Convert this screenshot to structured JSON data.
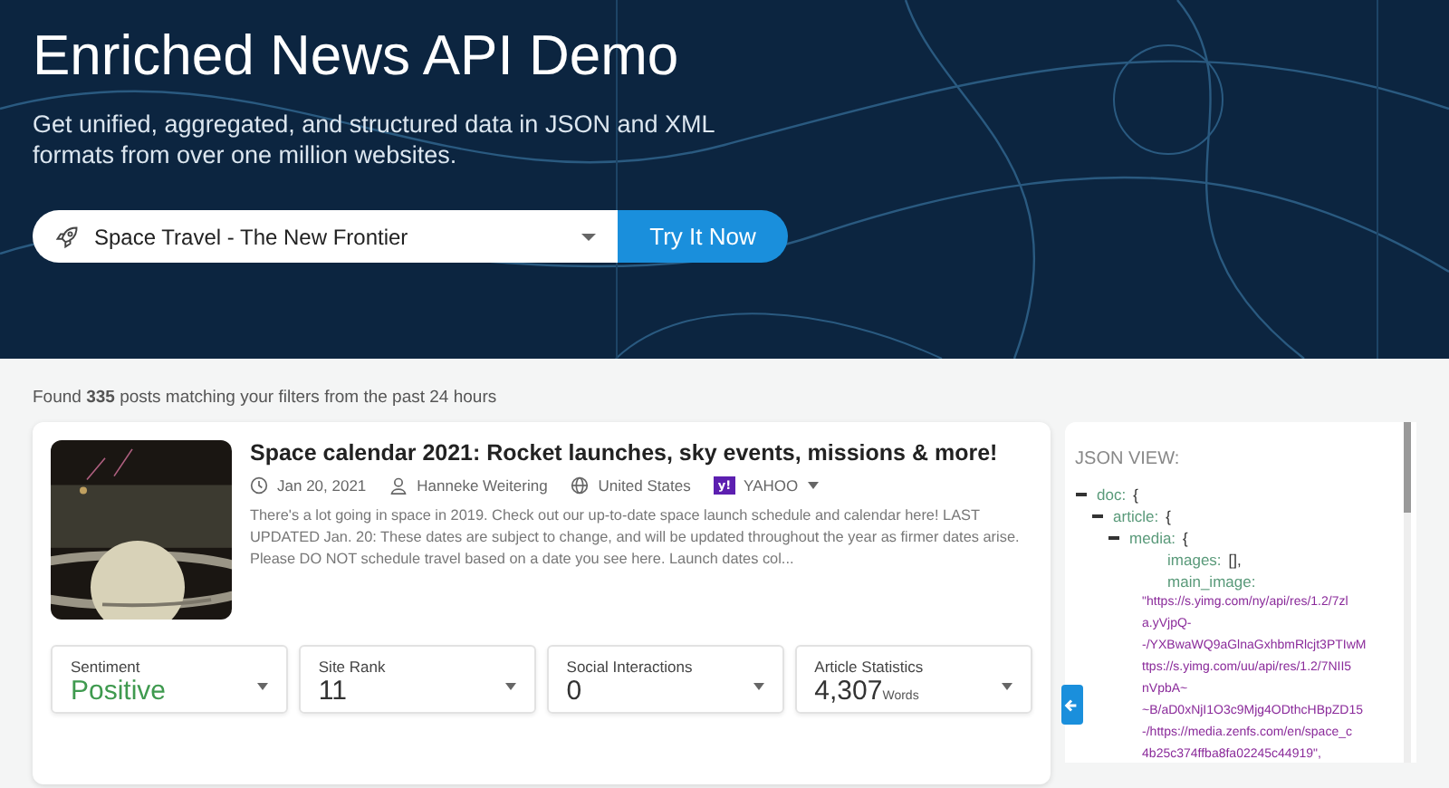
{
  "hero": {
    "title": "Enriched News API Demo",
    "subtitle": "Get unified, aggregated, and structured data in JSON and XML formats from over one million websites.",
    "select_value": "Space Travel - The New Frontier",
    "button": "Try It Now"
  },
  "results": {
    "count": "335",
    "summary_before": "Found",
    "summary_after": "posts matching your filters from the past 24 hours"
  },
  "article": {
    "title": "Space calendar 2021: Rocket launches, sky events, missions & more!",
    "date": "Jan 20, 2021",
    "author": "Hanneke Weitering",
    "country": "United States",
    "source_badge": "y!",
    "source": "YAHOO",
    "excerpt": "There's a lot going in space in 2019. Check out our up-to-date space launch schedule and calendar here! LAST UPDATED Jan. 20: These dates are subject to change, and will be updated throughout the year as firmer dates arise. Please DO NOT schedule travel based on a date you see here. Launch dates col...",
    "stats": [
      {
        "kind": "sentiment",
        "label": "Sentiment",
        "value": "Positive"
      },
      {
        "kind": "number",
        "label": "Site Rank",
        "value": "11"
      },
      {
        "kind": "number",
        "label": "Social Interactions",
        "value": "0"
      },
      {
        "kind": "number",
        "label": "Article Statistics",
        "value": "4,307",
        "unit": "Words"
      }
    ]
  },
  "json_view": {
    "title": "JSON VIEW:",
    "tree": [
      {
        "key": "doc:",
        "open": "{",
        "expanded": true,
        "children": [
          {
            "key": "article:",
            "open": "{",
            "expanded": true,
            "children": [
              {
                "key": "media:",
                "open": "{",
                "expanded": true,
                "children": [
                  {
                    "key": "images:",
                    "value": "[],"
                  },
                  {
                    "key": "main_image:",
                    "value_lines": [
                      "\"https://s.yimg.com/ny/api/res/1.2/7zl",
                      "a.yVjpQ-",
                      "-/YXBwaWQ9aGlnaGxhbmRlcjt3PTIwM",
                      "ttps://s.yimg.com/uu/api/res/1.2/7NII5",
                      "nVpbA~",
                      "~B/aD0xNjI1O3c9Mjg4ODthcHBpZD15",
                      "-/https://media.zenfs.com/en/space_c",
                      "4b25c374ffba8fa02245c44919\","
                    ]
                  }
                ]
              }
            ]
          }
        ]
      }
    ]
  }
}
